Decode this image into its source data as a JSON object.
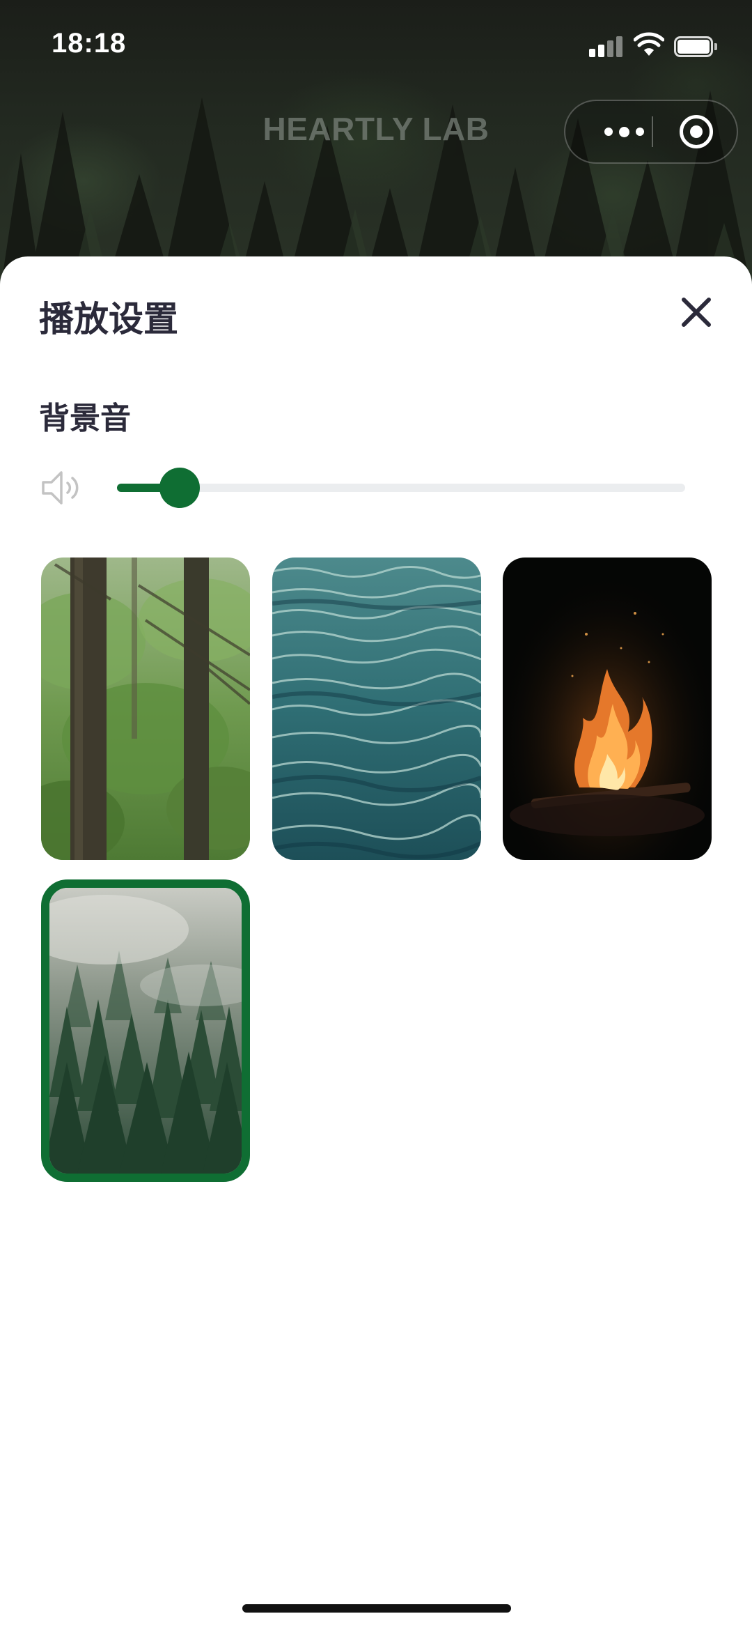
{
  "status_bar": {
    "time": "18:18"
  },
  "nav": {
    "title": "HEARTLY LAB"
  },
  "sheet": {
    "title": "播放设置",
    "section_label": "背景音",
    "volume": {
      "value": 0.08
    }
  },
  "sounds": [
    {
      "icon": "forest-image",
      "selected": false
    },
    {
      "icon": "ocean-waves-image",
      "selected": false
    },
    {
      "icon": "campfire-image",
      "selected": false
    },
    {
      "icon": "misty-pine-forest-image",
      "selected": true
    }
  ],
  "colors": {
    "accent": "#0f6e33",
    "text": "#2b2a3a",
    "track": "#ebedef"
  }
}
